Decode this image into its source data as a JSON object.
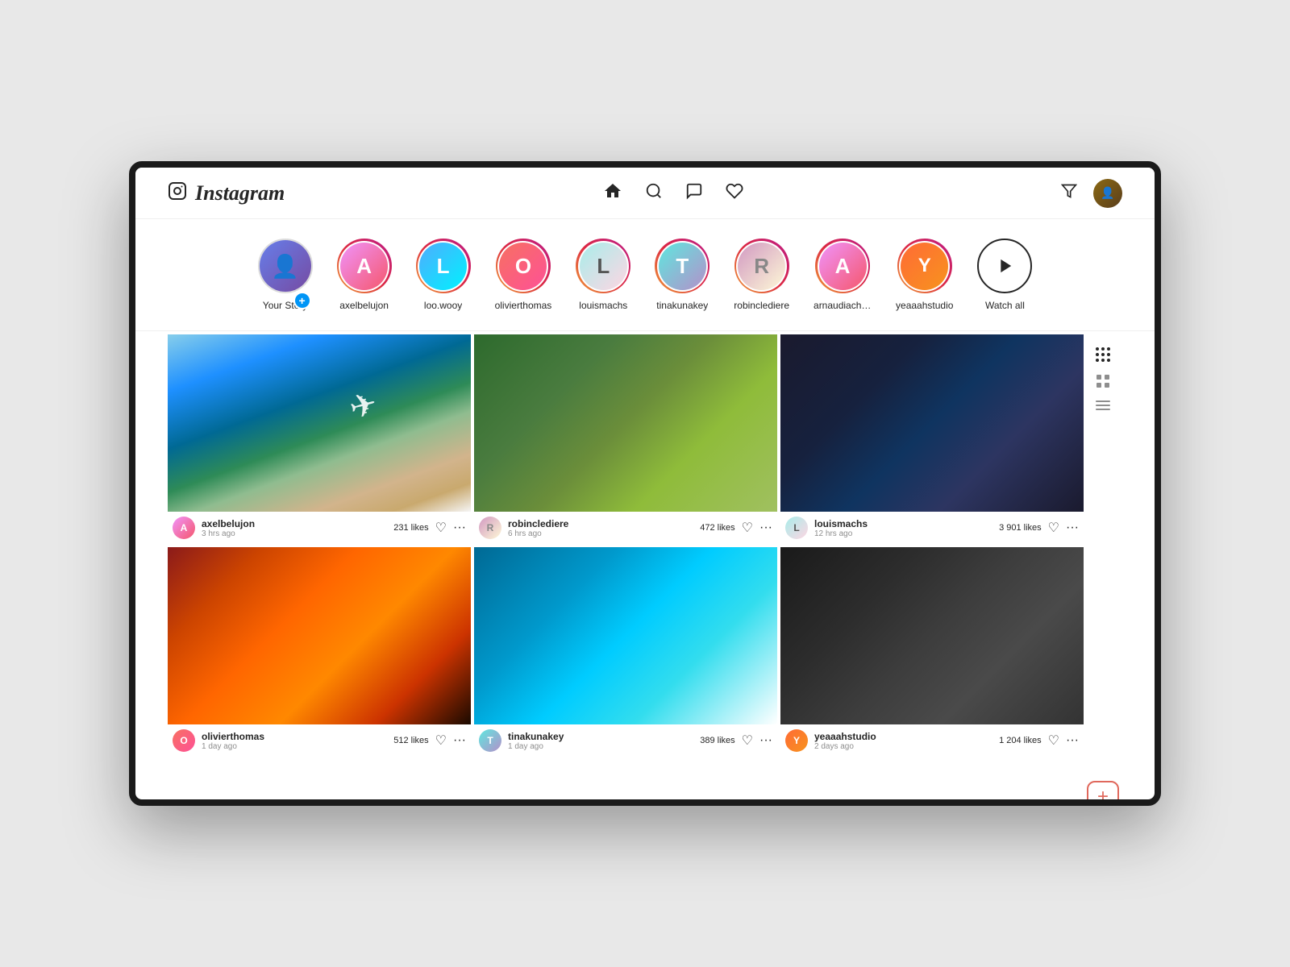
{
  "app": {
    "name": "Instagram",
    "logo_unicode": "📷"
  },
  "header": {
    "logo_text": "Instagram",
    "nav_icons": [
      "home",
      "search",
      "messenger",
      "heart"
    ],
    "action_icons": [
      "filter",
      "user"
    ]
  },
  "stories": {
    "items": [
      {
        "id": "your-story",
        "username": "Your Story",
        "has_story": false,
        "is_own": true,
        "avatar_color": "av-1"
      },
      {
        "id": "axelbelujon",
        "username": "axelbelujon",
        "has_story": true,
        "avatar_color": "av-2"
      },
      {
        "id": "loo-wooy",
        "username": "loo.wooy",
        "has_story": true,
        "avatar_color": "av-3"
      },
      {
        "id": "olivierthomas",
        "username": "olivierthomas",
        "has_story": true,
        "avatar_color": "av-4"
      },
      {
        "id": "louismachs",
        "username": "louismachs",
        "has_story": true,
        "avatar_color": "av-5"
      },
      {
        "id": "tinakunakey",
        "username": "tinakunakey",
        "has_story": true,
        "avatar_color": "av-6"
      },
      {
        "id": "robinclediere",
        "username": "robinclediere",
        "has_story": true,
        "avatar_color": "av-7"
      },
      {
        "id": "arnaudiachaise",
        "username": "arnaudiachaise",
        "has_story": true,
        "avatar_color": "av-2"
      },
      {
        "id": "yeaaahstudio",
        "username": "yeaaahstudio",
        "has_story": true,
        "avatar_color": "av-8"
      },
      {
        "id": "watch-all",
        "username": "Watch all",
        "is_watch_all": true
      }
    ]
  },
  "posts": [
    {
      "id": "post-1",
      "username": "axelbelujon",
      "time": "3 hrs ago",
      "likes": "231 likes",
      "img_class": "post-img-1",
      "avatar_color": "av-2"
    },
    {
      "id": "post-2",
      "username": "robinclediere",
      "time": "6 hrs ago",
      "likes": "472 likes",
      "img_class": "post-img-2",
      "avatar_color": "av-7"
    },
    {
      "id": "post-3",
      "username": "louismachs",
      "time": "12 hrs ago",
      "likes": "3 901 likes",
      "img_class": "post-img-3",
      "avatar_color": "av-5"
    },
    {
      "id": "post-4",
      "username": "olivierthomas",
      "time": "1 day ago",
      "likes": "512 likes",
      "img_class": "post-img-4",
      "avatar_color": "av-4"
    },
    {
      "id": "post-5",
      "username": "tinakunakey",
      "time": "1 day ago",
      "likes": "389 likes",
      "img_class": "post-img-5",
      "avatar_color": "av-6"
    },
    {
      "id": "post-6",
      "username": "yeaaahstudio",
      "time": "2 days ago",
      "likes": "1 204 likes",
      "img_class": "post-img-6",
      "avatar_color": "av-8"
    }
  ],
  "sidebar": {
    "add_button_label": "+"
  }
}
